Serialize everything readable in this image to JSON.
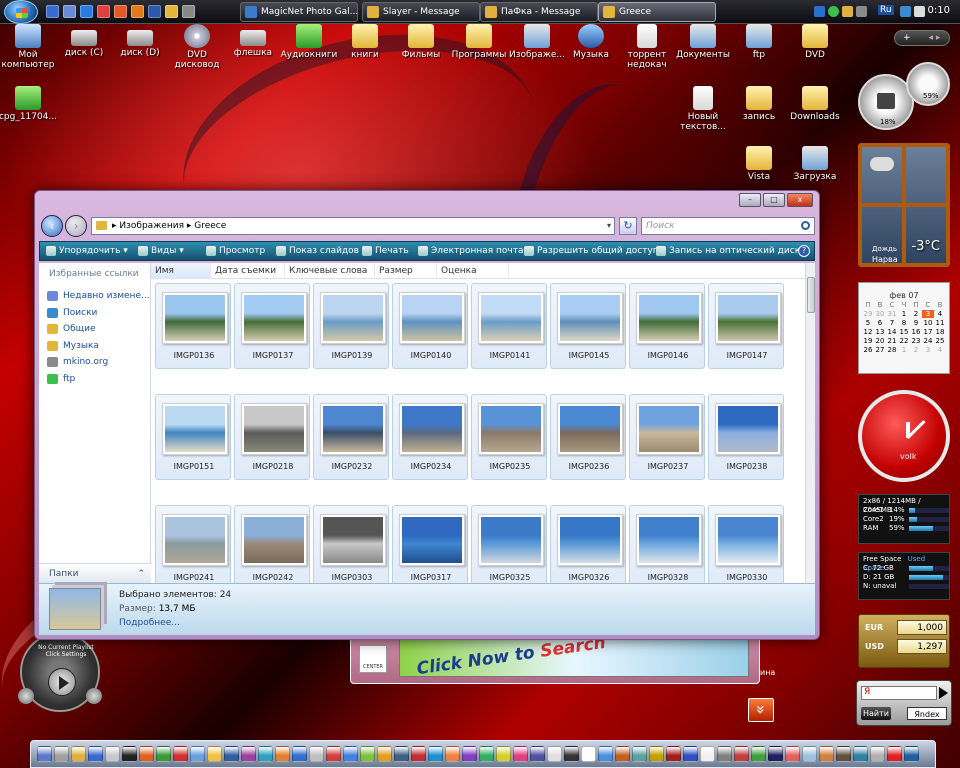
{
  "taskbar": {
    "quick_launch": [
      "show-desktop-icon",
      "switch-windows-icon",
      "ie-icon",
      "media-icon",
      "opera-icon",
      "firefox-icon",
      "photoshop-icon",
      "folder-icon",
      "settings-icon"
    ],
    "tasks": [
      {
        "label": "MagicNet Photo Gal...",
        "color": "#3a7ad0"
      },
      {
        "label": "Slayer - Message",
        "color": "#e0b040"
      },
      {
        "label": "ПаФка - Message",
        "color": "#e0b040"
      },
      {
        "label": "Greece",
        "color": "#e3b53a",
        "active": true
      }
    ],
    "tray_lang": "Ru",
    "clock": "0:10"
  },
  "desktop_icons": [
    {
      "label": "Мой компьютер",
      "type": "pc"
    },
    {
      "label": "диск (C)",
      "type": "drive"
    },
    {
      "label": "диск (D)",
      "type": "drive"
    },
    {
      "label": "DVD дисковод",
      "type": "dvd"
    },
    {
      "label": "флешка",
      "type": "drive"
    },
    {
      "label": "Аудиокниги",
      "type": "green"
    },
    {
      "label": "книги",
      "type": "folder"
    },
    {
      "label": "Фильмы",
      "type": "folder"
    },
    {
      "label": "Программы",
      "type": "folder"
    },
    {
      "label": "Изображе...",
      "type": "setup"
    },
    {
      "label": "Музыка",
      "type": "media"
    },
    {
      "label": "торрент недокач",
      "type": "doc"
    },
    {
      "label": "Документы",
      "type": "setup"
    },
    {
      "label": "ftp",
      "type": "setup"
    },
    {
      "label": "DVD",
      "type": "folder"
    },
    {
      "label": "cpg_11704...",
      "type": "green"
    },
    {
      "label": "Новый текстов...",
      "type": "doc"
    },
    {
      "label": "запись",
      "type": "folder"
    },
    {
      "label": "Downloads",
      "type": "folder"
    },
    {
      "label": "Vista",
      "type": "folder"
    },
    {
      "label": "Загрузка",
      "type": "setup"
    }
  ],
  "gadgets": {
    "sidebar_control": "+",
    "gauges": [
      {
        "percent": "18%"
      },
      {
        "percent": "59%"
      }
    ],
    "weather": {
      "temperature": "-3°C",
      "condition": "Дождь",
      "city": "Нарва"
    },
    "calendar": {
      "month": "фев 07",
      "weekdays": [
        "П",
        "В",
        "С",
        "Ч",
        "П",
        "С",
        "В"
      ],
      "days": [
        "29",
        "30",
        "31",
        "1",
        "2",
        "3",
        "4",
        "5",
        "6",
        "7",
        "8",
        "9",
        "10",
        "11",
        "12",
        "13",
        "14",
        "15",
        "16",
        "17",
        "18",
        "19",
        "20",
        "21",
        "22",
        "23",
        "24",
        "25",
        "26",
        "27",
        "28",
        "1",
        "2",
        "3",
        "4"
      ],
      "today": "3"
    },
    "clock": {
      "brand": "volk"
    },
    "cpu": {
      "header": "2x86 / 1214MB / 2045MB",
      "rows": [
        {
          "name": "Core1",
          "value": "14%",
          "level": 0.14
        },
        {
          "name": "Core2",
          "value": "19%",
          "level": 0.19
        },
        {
          "name": "RAM",
          "value": "59%",
          "level": 0.59
        }
      ]
    },
    "drives": {
      "header_free": "Free Space",
      "header_used": "Used Space",
      "rows": [
        {
          "name": "C: 72 GB",
          "level": 0.6
        },
        {
          "name": "D: 21 GB",
          "level": 0.85
        },
        {
          "name": "N: unaval",
          "level": 0.0
        }
      ]
    },
    "currency": [
      {
        "name": "EUR",
        "value": "1,000"
      },
      {
        "name": "USD",
        "value": "1,297"
      }
    ],
    "yandex": {
      "logo_letter": "Я",
      "button": "Найти",
      "logo": "Яndex"
    },
    "media_player": {
      "status": "No Current Playlist",
      "hint": "Click Settings"
    }
  },
  "ad": {
    "text_main": "Click Now to",
    "text_red": "Search",
    "logo": "CENTER",
    "tail": "ина"
  },
  "explorer": {
    "controls": {
      "minimize": "–",
      "maximize": "□",
      "close": "x"
    },
    "address": {
      "root": "Изображения",
      "folder": "Greece"
    },
    "search_placeholder": "Поиск",
    "commands": [
      "Упорядочить ▾",
      "Виды ▾",
      "Просмотр",
      "Показ слайдов",
      "Печать",
      "Электронная почта",
      "Разрешить общий доступ",
      "Запись на оптический диск"
    ],
    "nav_heading": "Избранные ссылки",
    "nav_items": [
      "Недавно измене...",
      "Поиски",
      "Общие",
      "Музыка",
      "mkino.org",
      "ftp"
    ],
    "folders_label": "Папки",
    "columns": [
      "Имя",
      "Дата съемки",
      "Ключевые слова",
      "Размер",
      "Оценка"
    ],
    "files": [
      {
        "name": "IMGP0136",
        "colors": [
          "#9bc6f0",
          "#3f6a3a",
          "#d8d0b8"
        ]
      },
      {
        "name": "IMGP0137",
        "colors": [
          "#a4cbf2",
          "#456e3a",
          "#d6cdb0"
        ]
      },
      {
        "name": "IMGP0139",
        "colors": [
          "#bcd6f2",
          "#6a9bc6",
          "#d4c9a8"
        ]
      },
      {
        "name": "IMGP0140",
        "colors": [
          "#b8d4f2",
          "#5f92c0",
          "#cfc3a0"
        ]
      },
      {
        "name": "IMGP0141",
        "colors": [
          "#c2dcf6",
          "#6a9dc8",
          "#d9cfb4"
        ]
      },
      {
        "name": "IMGP0145",
        "colors": [
          "#a9cdf2",
          "#5f8fb9",
          "#e0d8c4"
        ]
      },
      {
        "name": "IMGP0146",
        "colors": [
          "#9fc7f0",
          "#416c39",
          "#d8ceb3"
        ]
      },
      {
        "name": "IMGP0147",
        "colors": [
          "#a8cbee",
          "#4a7236",
          "#cfc7ae"
        ]
      },
      {
        "name": "IMGP0151",
        "colors": [
          "#bcd9f4",
          "#3f84c0",
          "#e4dcc8"
        ]
      },
      {
        "name": "IMGP0218",
        "colors": [
          "#c8c8c8",
          "#5a5a5a",
          "#8a8a7a"
        ]
      },
      {
        "name": "IMGP0232",
        "colors": [
          "#4f86d0",
          "#3a4e6a",
          "#c8b89a"
        ]
      },
      {
        "name": "IMGP0234",
        "colors": [
          "#3f78c8",
          "#5a6a80",
          "#c0b090"
        ]
      },
      {
        "name": "IMGP0235",
        "colors": [
          "#5a92d8",
          "#8a7a6a",
          "#b8a890"
        ]
      },
      {
        "name": "IMGP0236",
        "colors": [
          "#4a88d2",
          "#7a6a5a",
          "#a89880"
        ]
      },
      {
        "name": "IMGP0237",
        "colors": [
          "#6fa2dc",
          "#c9b89a",
          "#9a8a70"
        ]
      },
      {
        "name": "IMGP0238",
        "colors": [
          "#2f6ac0",
          "#8ab0e0",
          "#b0b8c8"
        ]
      },
      {
        "name": "IMGP0241",
        "colors": [
          "#aac4e0",
          "#8a9aa0",
          "#b0a898"
        ]
      },
      {
        "name": "IMGP0242",
        "colors": [
          "#8ab0d8",
          "#9a8a7a",
          "#7a6a5a"
        ]
      },
      {
        "name": "IMGP0303",
        "colors": [
          "#555555",
          "#c8c8c8",
          "#888888"
        ]
      },
      {
        "name": "IMGP0317",
        "colors": [
          "#2f6ac0",
          "#3f86d0",
          "#1f4f90"
        ]
      },
      {
        "name": "IMGP0325",
        "colors": [
          "#3a7ac8",
          "#5a9ad8",
          "#d0d8e0"
        ]
      },
      {
        "name": "IMGP0326",
        "colors": [
          "#3676c6",
          "#5898d6",
          "#d8dfe6"
        ]
      },
      {
        "name": "IMGP0328",
        "colors": [
          "#3f7fcc",
          "#6aa6de",
          "#e0e6ec"
        ]
      },
      {
        "name": "IMGP0330",
        "colors": [
          "#4a86d0",
          "#78b0e2",
          "#e6ecf2"
        ]
      }
    ],
    "details": {
      "selected": "Выбрано элементов: 24",
      "size_label": "Размер:",
      "size_value": "13,7 МБ",
      "more": "Подробнее..."
    }
  },
  "dock_colors": [
    "#5a7ac8",
    "#a0a0a0",
    "#e0b040",
    "#3a6ad0",
    "#c8c8d0",
    "#222222",
    "#e06020",
    "#3a9a3a",
    "#d03030",
    "#6aa0e0",
    "#f0c040",
    "#2f5fa0",
    "#a040a0",
    "#30a0c0",
    "#e08030",
    "#3070d0",
    "#c0c0c0",
    "#d04040",
    "#4080e0",
    "#80c040",
    "#e0a020",
    "#406080",
    "#c03030",
    "#2090d0",
    "#f08040",
    "#8040c0",
    "#30b060",
    "#d0d030",
    "#e04080",
    "#5050a0",
    "#e0e0e0",
    "#333333",
    "#ffffff",
    "#4a90e0",
    "#c06020",
    "#60a0a0",
    "#c0a000",
    "#a02020",
    "#3050c0",
    "#f0f0f0",
    "#808080",
    "#c04040",
    "#40a040",
    "#202060",
    "#e06060",
    "#a0c0e0",
    "#d08040",
    "#605040",
    "#3080a0",
    "#b0b0b0",
    "#e02020",
    "#2060a0"
  ]
}
